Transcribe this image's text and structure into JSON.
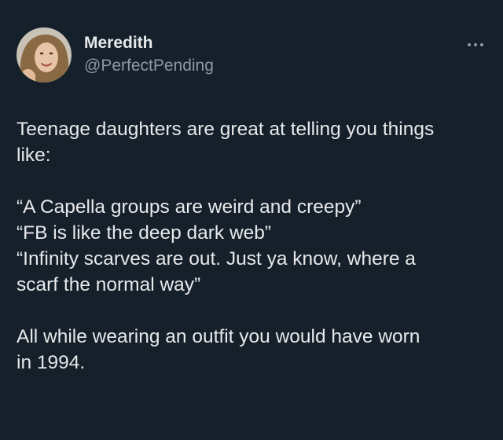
{
  "author": {
    "display_name": "Meredith",
    "handle": "@PerfectPending",
    "avatar_icon": "profile-photo"
  },
  "actions": {
    "more_icon": "more-horizontal-icon"
  },
  "tweet": {
    "paragraphs": [
      "Teenage daughters are great at telling you things\nlike:",
      "“A Capella groups are weird and creepy”\n“FB is like the deep dark web”\n“Infinity scarves are out. Just ya know, where a\nscarf the normal way”",
      "All while wearing an outfit you would have worn\nin 1994."
    ]
  },
  "colors": {
    "background": "#15202b",
    "text": "#e7e9ea",
    "secondary_text": "#8b98a5"
  }
}
